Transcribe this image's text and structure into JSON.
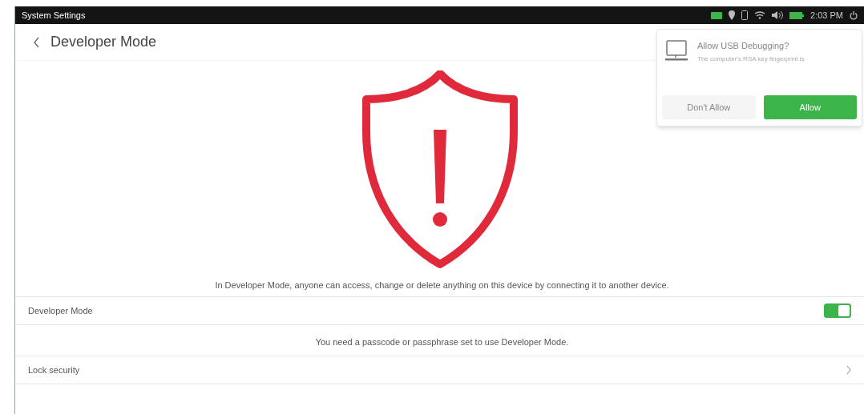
{
  "status_bar": {
    "app_name": "System Settings",
    "time": "2:03 PM"
  },
  "header": {
    "title": "Developer Mode"
  },
  "warning": "In Developer Mode, anyone can access, change or delete anything on this device by connecting it to another device.",
  "developer_mode": {
    "label": "Developer Mode",
    "on": true
  },
  "note": "You need a passcode or passphrase set to use Developer Mode.",
  "lock_security": {
    "label": "Lock security"
  },
  "dialog": {
    "title": "Allow USB Debugging?",
    "message": "The computer's RSA key fingerprint is",
    "buttons": [
      {
        "label": "Don't Allow",
        "kind": "secondary"
      },
      {
        "label": "Allow",
        "kind": "primary"
      }
    ]
  }
}
